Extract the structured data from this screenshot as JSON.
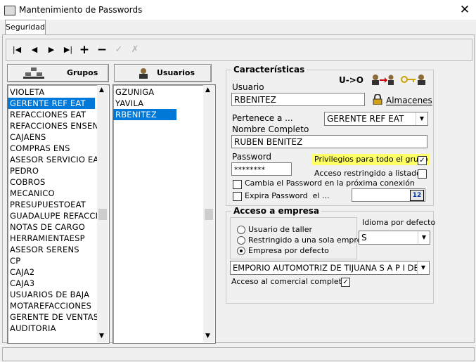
{
  "window": {
    "title": "Mantenimiento de Passwords",
    "close_glyph": "✕"
  },
  "tabs": [
    {
      "label": "Seguridad"
    }
  ],
  "toolbar": {
    "first": "|◀",
    "prev": "◀",
    "next": "▶",
    "last": "▶|",
    "add": "+",
    "remove": "−",
    "confirm": "✓",
    "cancel": "✗"
  },
  "grupos": {
    "button_label": "Grupos",
    "items": [
      "VIOLETA",
      "GERENTE REF EAT",
      "REFACCIONES EAT",
      "REFACCIONES ENSENA",
      "CAJAENS",
      "COMPRAS ENS",
      "ASESOR SERVICIO EAT",
      "PEDRO",
      "COBROS",
      "MECANICO",
      "PRESUPUESTOEAT",
      "GUADALUPE REFACCIO",
      "NOTAS DE CARGO",
      "HERRAMIENTAESP",
      "ASESOR SERENS",
      "CP",
      "CAJA2",
      "CAJA3",
      "USUARIOS DE BAJA",
      "MOTAREFACCIONES",
      "GERENTE DE VENTAS",
      "AUDITORIA"
    ],
    "selected_index": 1
  },
  "usuarios": {
    "button_label": "Usuarios",
    "items": [
      "GZUNIGA",
      "YAVILA",
      "RBENITEZ"
    ],
    "selected_index": 2
  },
  "caracteristicas": {
    "legend": "Características",
    "u_to_o": "U->O",
    "usuario_label": "Usuario",
    "usuario_value": "RBENITEZ",
    "almacenes_label": "Almacenes",
    "pertenece_label": "Pertenece a ...",
    "pertenece_value": "GERENTE REF EAT",
    "nombre_label": "Nombre Completo",
    "nombre_value": "RUBEN BENITEZ",
    "password_label": "Password",
    "password_value": "********",
    "privilegios_label": "Privilegios para todo el grupo",
    "privilegios_checked": true,
    "acceso_listados_label": "Acceso restringido a listados",
    "acceso_listados_checked": false,
    "cambia_label": "Cambia el Password en la próxima conexión",
    "cambia_checked": false,
    "expira_label": "Expira Password  el ...",
    "expira_checked": false,
    "calendar_glyph": "12",
    "highlight_color": "#ffff66"
  },
  "acceso_empresa": {
    "legend": "Acceso a empresa",
    "radios": [
      {
        "label": "Usuario de taller",
        "checked": false
      },
      {
        "label": "Restringido a una sola empresa",
        "checked": false
      },
      {
        "label": "Empresa por defecto",
        "checked": true
      }
    ],
    "idioma_label": "Idioma por defecto",
    "idioma_value": "S",
    "empresa_value": "EMPORIO AUTOMOTRIZ DE TIJUANA S A P I DE CV",
    "comercial_label": "Acceso al comercial completo",
    "comercial_checked": true
  },
  "colors": {
    "selection": "#0078d7",
    "panel": "#f0f0f0"
  }
}
